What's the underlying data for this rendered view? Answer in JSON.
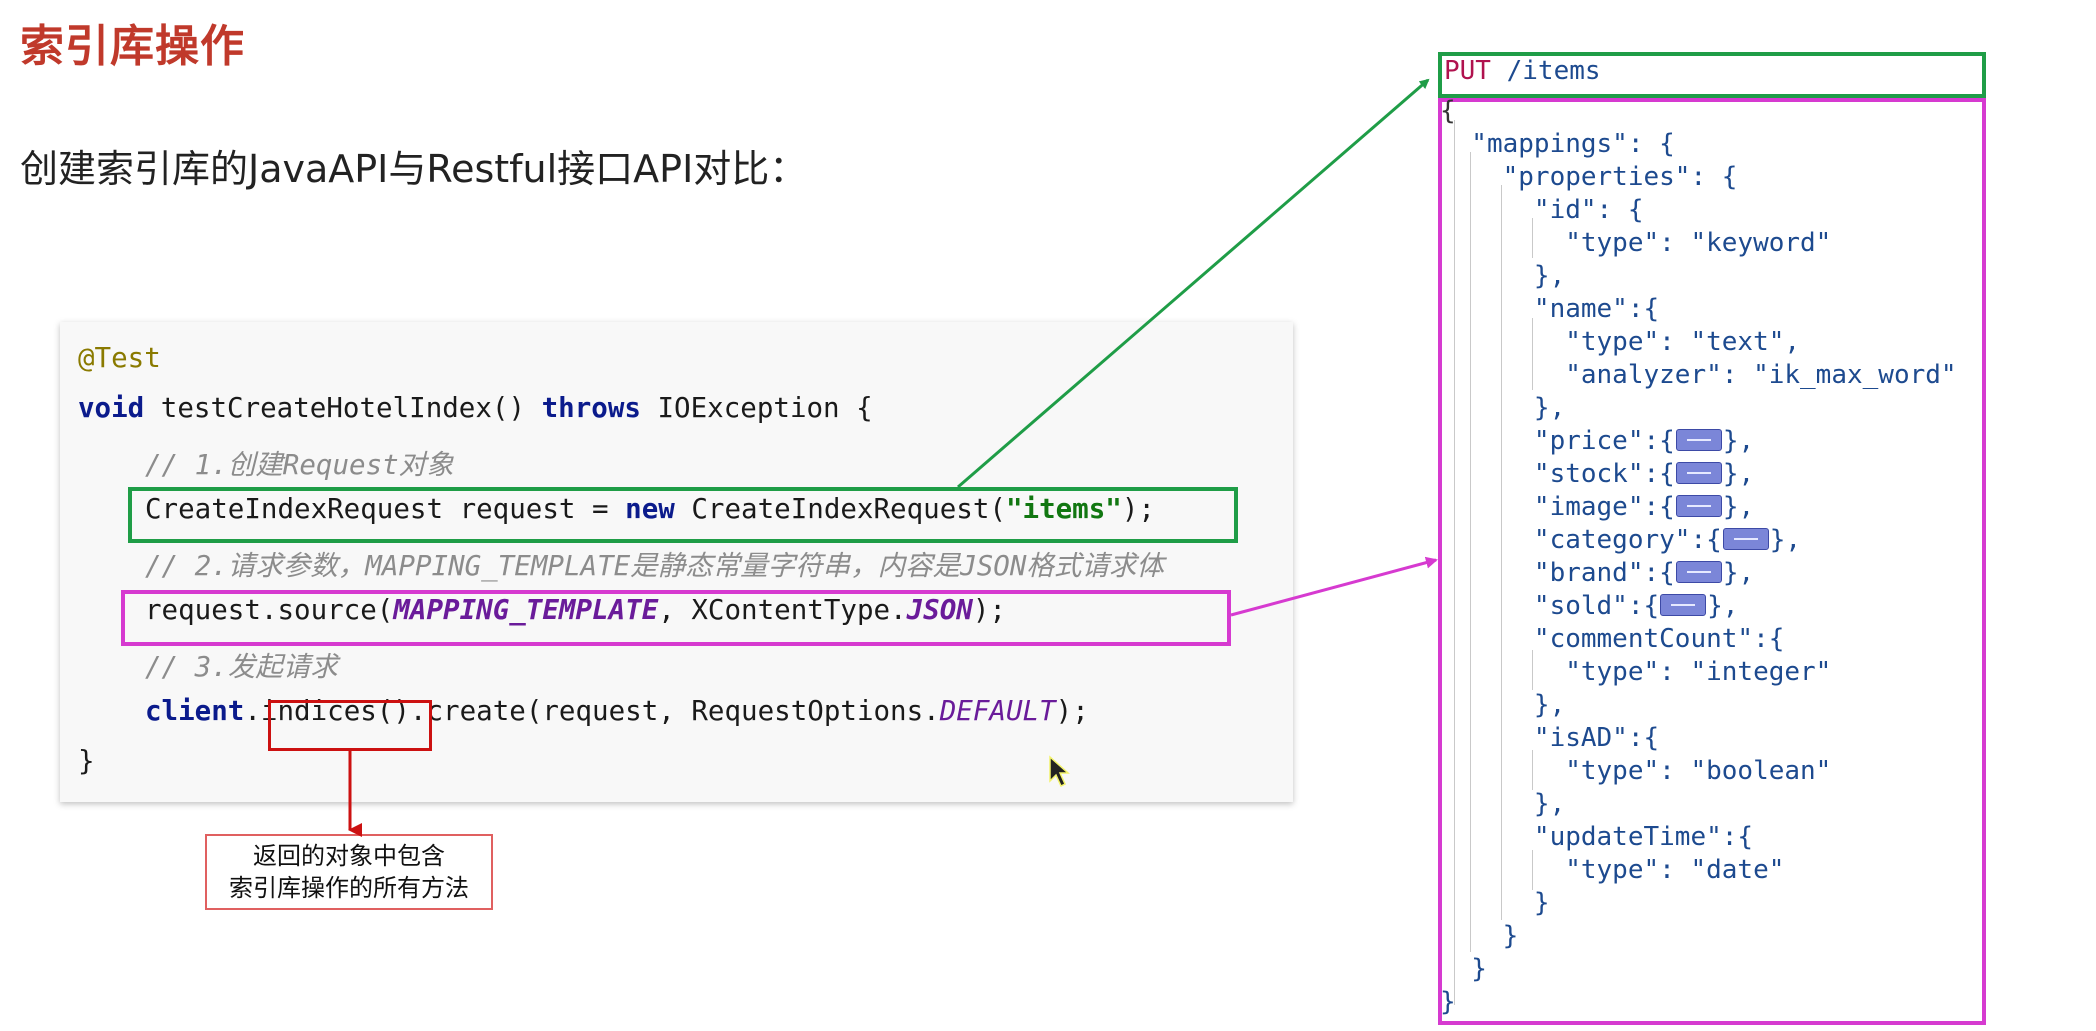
{
  "title": "索引库操作",
  "subtitle": "创建索引库的JavaAPI与Restful接口API对比：",
  "java_code": {
    "annotation": "@Test",
    "sig_void": "void",
    "sig_method": " testCreateHotelIndex() ",
    "sig_throws": "throws",
    "sig_exception": " IOException {",
    "comment1": "// 1.创建Request对象",
    "line2_a": "CreateIndexRequest request = ",
    "line2_new": "new",
    "line2_b": " CreateIndexRequest(",
    "line2_str": "\"items\"",
    "line2_c": ");",
    "comment2": "// 2.请求参数，MAPPING_TEMPLATE是静态常量字符串，内容是JSON格式请求体",
    "line3_a": "request.source(",
    "line3_const": "MAPPING_TEMPLATE",
    "line3_b": ", XContentType.",
    "line3_json": "JSON",
    "line3_c": ");",
    "comment3": "// 3.发起请求",
    "line4_client": "client",
    "line4_dot": ".",
    "line4_indices": "indices()",
    "line4_b": ".create(request, RequestOptions.",
    "line4_default": "DEFAULT",
    "line4_c": ");",
    "closing": "}"
  },
  "tooltip": {
    "line1": "返回的对象中包含",
    "line2": "索引库操作的所有方法"
  },
  "rest_request": {
    "method": "PUT",
    "path": " /items",
    "lines": [
      "{",
      "  \"mappings\": {",
      "    \"properties\": {",
      "      \"id\": {",
      "        \"type\": \"keyword\"",
      "      },",
      "      \"name\":{",
      "        \"type\": \"text\",",
      "        \"analyzer\": \"ik_max_word\"",
      "      },",
      "      \"price\":{",
      "      \"stock\":{",
      "      \"image\":{",
      "      \"category\":{",
      "      \"brand\":{",
      "      \"sold\":{",
      "      \"commentCount\":{",
      "        \"type\": \"integer\"",
      "      },",
      "      \"isAD\":{",
      "        \"type\": \"boolean\"",
      "      },",
      "      \"updateTime\":{",
      "        \"type\": \"date\"",
      "      }",
      "    }",
      "  }",
      "}"
    ],
    "folded_suffix": "},"
  }
}
